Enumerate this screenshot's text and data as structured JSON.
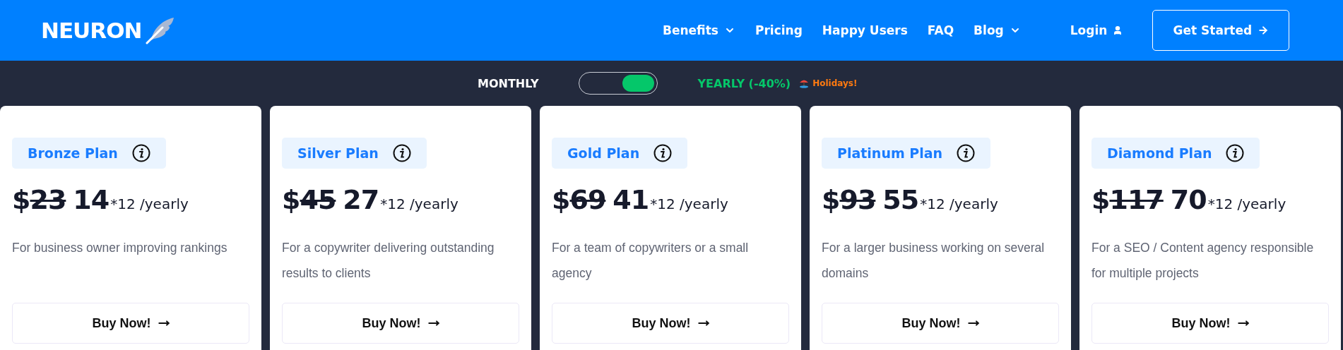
{
  "header": {
    "logo": "NEURON",
    "nav": [
      {
        "label": "Benefits",
        "dropdown": true
      },
      {
        "label": "Pricing",
        "dropdown": false
      },
      {
        "label": "Happy Users",
        "dropdown": false
      },
      {
        "label": "FAQ",
        "dropdown": false
      },
      {
        "label": "Blog",
        "dropdown": true
      }
    ],
    "login": "Login",
    "cta": "Get Started"
  },
  "billing": {
    "monthly_label": "MONTHLY",
    "yearly_label": "YEARLY (-40%)",
    "yearly_selected": true,
    "promo": "Holidays!"
  },
  "plans": [
    {
      "name": "Bronze Plan",
      "currency": "$",
      "old_price": "23",
      "price": "14",
      "suffix": "*12 /yearly",
      "description": "For business owner improving rankings",
      "button": "Buy Now!"
    },
    {
      "name": "Silver Plan",
      "currency": "$",
      "old_price": "45",
      "price": "27",
      "suffix": "*12 /yearly",
      "description": "For a copywriter delivering outstanding results to clients",
      "button": "Buy Now!"
    },
    {
      "name": "Gold Plan",
      "currency": "$",
      "old_price": "69",
      "price": "41",
      "suffix": "*12 /yearly",
      "description": "For a team of copywriters or a small agency",
      "button": "Buy Now!"
    },
    {
      "name": "Platinum Plan",
      "currency": "$",
      "old_price": "93",
      "price": "55",
      "suffix": "*12 /yearly",
      "description": "For a larger business working on several domains",
      "button": "Buy Now!"
    },
    {
      "name": "Diamond Plan",
      "currency": "$",
      "old_price": "117",
      "price": "70",
      "suffix": "*12 /yearly",
      "description": "For a SEO / Content agency responsible for multiple projects",
      "button": "Buy Now!"
    }
  ]
}
